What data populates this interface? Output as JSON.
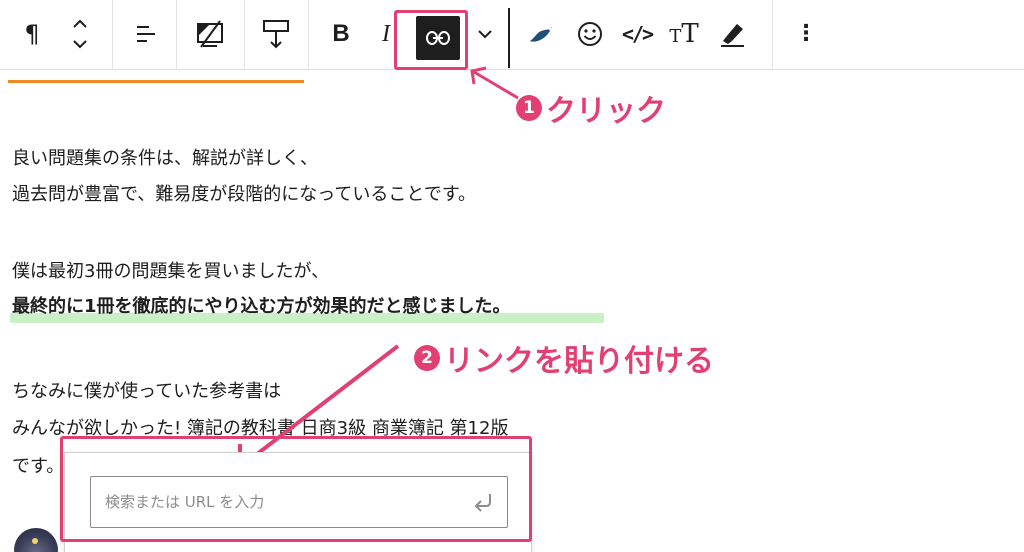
{
  "toolbar": {
    "tools": [
      {
        "name": "paragraph",
        "icon": "pilcrow-icon",
        "glyph": "¶"
      },
      {
        "name": "move",
        "icon": "move-updown-icon"
      },
      {
        "name": "align",
        "icon": "align-left-icon"
      },
      {
        "name": "image-off",
        "icon": "image-off-icon"
      },
      {
        "name": "spacer",
        "icon": "spacer-icon"
      },
      {
        "name": "bold",
        "icon": "bold-icon",
        "glyph": "B"
      },
      {
        "name": "italic",
        "icon": "italic-icon",
        "glyph": "I"
      },
      {
        "name": "link",
        "icon": "link-icon",
        "active": true
      },
      {
        "name": "more-format",
        "icon": "chevron-down-icon"
      },
      {
        "name": "plugin",
        "icon": "leaf-icon"
      },
      {
        "name": "emoji",
        "icon": "smiley-icon"
      },
      {
        "name": "code",
        "icon": "code-icon",
        "glyph": "</>"
      },
      {
        "name": "text-size",
        "icon": "text-size-icon",
        "glyph_small": "T",
        "glyph_big": "T"
      },
      {
        "name": "highlight",
        "icon": "highlighter-icon"
      },
      {
        "name": "options",
        "icon": "more-vertical-icon",
        "glyph": "⋮"
      }
    ]
  },
  "annotations": {
    "step1": {
      "num": "1",
      "text": "クリック"
    },
    "step2": {
      "num": "2",
      "text": "リンクを貼り付ける"
    },
    "accent_color": "#e23f72"
  },
  "content": {
    "lines": [
      "良い問題集の条件は、解説が詳しく、",
      "過去問が豊富で、難易度が段階的になっていることです。",
      "僕は最初3冊の問題集を買いましたが、",
      "最終的に1冊を徹底的にやり込む方が効果的だと感じました。",
      "ちなみに僕が使っていた参考書は",
      "みんなが欲しかった! 簿記の教科書 日商3級 商業簿記 第12版",
      "です。"
    ],
    "highlight_color": "#c8f2c6"
  },
  "link_popover": {
    "placeholder": "検索または URL を入力",
    "value": "",
    "submit_icon": "enter-icon"
  }
}
